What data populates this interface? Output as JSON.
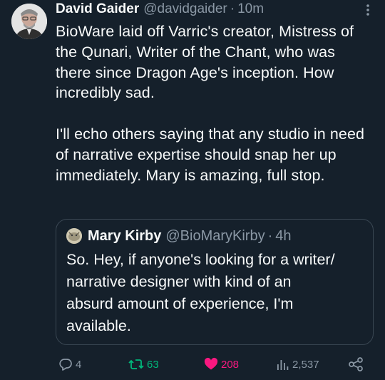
{
  "tweet": {
    "author_name": "David Gaider",
    "handle": "@davidgaider",
    "separator": "·",
    "time": "10m",
    "text": "BioWare laid off Varric's creator, Mistress of the Qunari, Writer of the Chant, who was there since Dragon Age's inception. How incredibly sad.\n\nI'll echo others saying that any studio in need of narrative expertise should snap her up immediately. Mary is amazing, full stop."
  },
  "quoted": {
    "author_name": "Mary Kirby",
    "handle": "@BioMaryKirby",
    "separator": "·",
    "time": "4h",
    "text": "So. Hey, if anyone's looking for a writer/\nnarrative designer with kind of an\nabsurd amount of experience, I'm\navailable."
  },
  "actions": {
    "replies": "4",
    "retweets": "63",
    "likes": "208",
    "views": "2,537"
  },
  "icons": {
    "more": "more-icon",
    "reply": "reply-icon",
    "retweet": "retweet-icon",
    "like": "heart-icon",
    "views": "views-icon",
    "share": "share-icon"
  },
  "colors": {
    "background": "#15202b",
    "text": "#f7f9f9",
    "muted": "#8b98a5",
    "retweet": "#00ba7c",
    "like": "#f91880"
  }
}
